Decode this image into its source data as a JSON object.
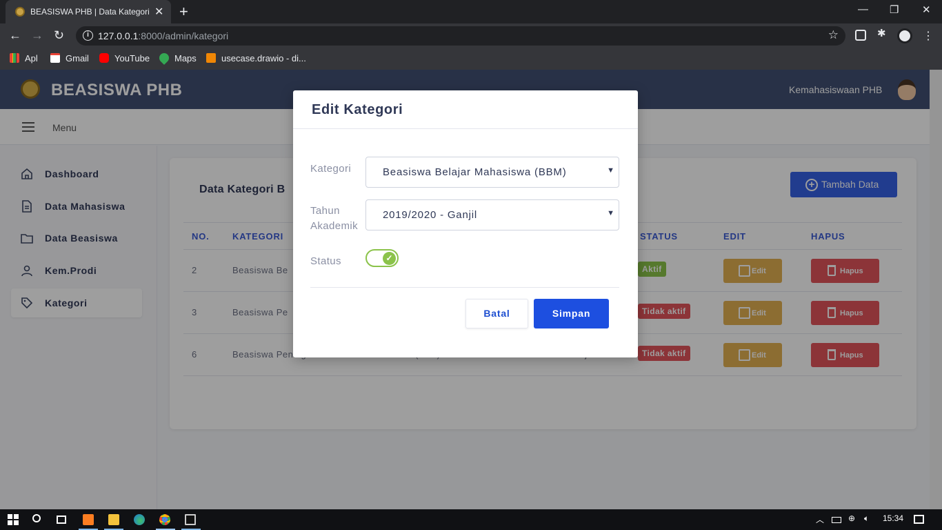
{
  "browser": {
    "tab_title": "BEASISWA PHB | Data Kategori",
    "url_host": "127.0.0.1",
    "url_path": ":8000/admin/kategori",
    "bookmarks": [
      "Apl",
      "Gmail",
      "YouTube",
      "Maps",
      "usecase.drawio - di..."
    ]
  },
  "header": {
    "brand": "BEASISWA PHB",
    "user_name": "Kemahasiswaan PHB"
  },
  "subheader": {
    "menu_label": "Menu"
  },
  "sidebar": {
    "items": [
      {
        "label": "Dashboard",
        "icon": "home-icon",
        "active": false
      },
      {
        "label": "Data Mahasiswa",
        "icon": "document-icon",
        "active": false
      },
      {
        "label": "Data Beasiswa",
        "icon": "folder-icon",
        "active": false
      },
      {
        "label": "Kem.Prodi",
        "icon": "user-icon",
        "active": false
      },
      {
        "label": "Kategori",
        "icon": "tag-icon",
        "active": true
      }
    ]
  },
  "card": {
    "title": "Data Kategori B",
    "add_button": "Tambah Data",
    "columns": [
      "NO.",
      "KATEGORI",
      "STATUS",
      "EDIT",
      "HAPUS"
    ],
    "rows": [
      {
        "no": "2",
        "kategori": "Beasiswa Be",
        "tahun": "",
        "status": "Aktif",
        "edit": "Edit",
        "hapus": "Hapus"
      },
      {
        "no": "3",
        "kategori": "Beasiswa Pe",
        "tahun": "",
        "status": "Tidak aktif",
        "edit": "Edit",
        "hapus": "Hapus"
      },
      {
        "no": "6",
        "kategori": "Beasiswa Peningkatan Prestasi Akademik (PPA)",
        "tahun": "2019/2020 - Ganjil",
        "status": "Tidak aktif",
        "edit": "Edit",
        "hapus": "Hapus"
      }
    ]
  },
  "modal": {
    "title": "Edit Kategori",
    "kategori_label": "Kategori",
    "kategori_value": "Beasiswa Belajar Mahasiswa (BBM)",
    "tahun_label_1": "Tahun",
    "tahun_label_2": "Akademik",
    "tahun_value": "2019/2020 - Ganjil",
    "status_label": "Status",
    "status_on": true,
    "cancel": "Batal",
    "save": "Simpan"
  },
  "taskbar": {
    "time": "15:34"
  },
  "colors": {
    "header_bg": "#414f73",
    "primary": "#1d4fe0",
    "aktif_badge": "#8bc34a",
    "tidak_aktif_badge": "#e2545b",
    "edit_button": "#e3b052",
    "hapus_button": "#e2545b"
  }
}
